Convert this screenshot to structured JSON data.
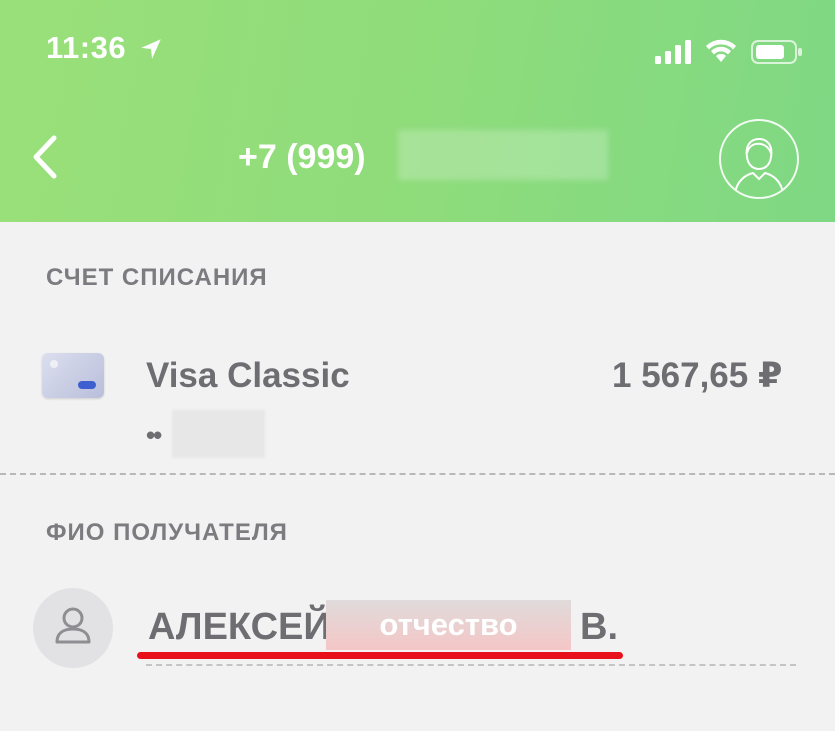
{
  "status_bar": {
    "time": "11:36",
    "icons": [
      "location-arrow-icon",
      "cellular-signal-icon",
      "wifi-icon",
      "battery-icon"
    ]
  },
  "header": {
    "phone_prefix": "+7 (999)",
    "back_icon": "chevron-left-icon",
    "profile_icon": "user-avatar-icon"
  },
  "debit_section": {
    "label": "СЧЕТ СПИСАНИЯ",
    "account_name": "Visa Classic",
    "balance": "1 567,65 ₽",
    "card_mask": "••"
  },
  "recipient_section": {
    "label": "ФИО ПОЛУЧАТЕЛЯ",
    "first_name": "АЛЕКСЕЙ",
    "patronymic_placeholder": "отчество",
    "last_initial": "В."
  },
  "colors": {
    "header_green": "#8fdc7b",
    "text_gray": "#6d6d72",
    "label_gray": "#7b7b80",
    "underline_red": "#e8101a",
    "background": "#f2f2f2"
  }
}
